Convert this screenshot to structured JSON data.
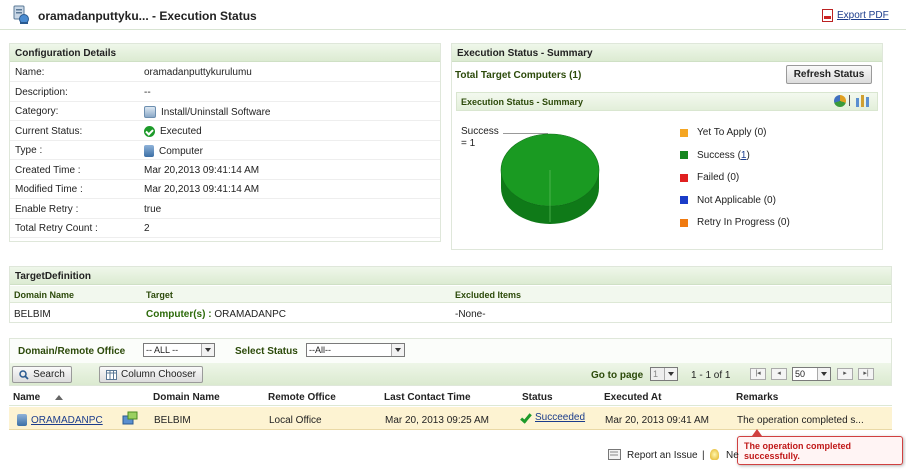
{
  "header": {
    "title": "oramadanputtyku... - Execution Status",
    "export_label": "Export PDF"
  },
  "config": {
    "heading": "Configuration Details",
    "rows": [
      {
        "label": "Name:",
        "value": "oramadanputtykurulumu",
        "icon": ""
      },
      {
        "label": "Description:",
        "value": "--",
        "icon": ""
      },
      {
        "label": "Category:",
        "value": "Install/Uninstall Software",
        "icon": "software-package-icon"
      },
      {
        "label": "Current Status:",
        "value": "Executed",
        "icon": "check-circle-icon"
      },
      {
        "label": "Type :",
        "value": "Computer",
        "icon": "computer-icon"
      },
      {
        "label": "Created Time :",
        "value": "Mar 20,2013 09:41:14 AM",
        "icon": ""
      },
      {
        "label": "Modified Time :",
        "value": "Mar 20,2013 09:41:14 AM",
        "icon": ""
      },
      {
        "label": "Enable Retry :",
        "value": "true",
        "icon": ""
      },
      {
        "label": "Total Retry Count :",
        "value": "2",
        "icon": ""
      }
    ]
  },
  "summary": {
    "heading": "Execution Status - Summary",
    "total_targets": "Total Target Computers (1)",
    "refresh_label": "Refresh Status",
    "subheading": "Execution Status - Summary",
    "pie_label": "Success",
    "pie_value": "= 1",
    "legend": [
      {
        "label": "Yet To Apply (0)",
        "color": "#f5a623",
        "link": "",
        "after": ""
      },
      {
        "label": "Success (",
        "color": "#15871f",
        "link": "1",
        "after": ")"
      },
      {
        "label": "Failed (0)",
        "color": "#e02020",
        "link": "",
        "after": ""
      },
      {
        "label": "Not Applicable (0)",
        "color": "#1a3cc8",
        "link": "",
        "after": ""
      },
      {
        "label": "Retry In Progress (0)",
        "color": "#f07a10",
        "link": "",
        "after": ""
      }
    ]
  },
  "chart_data": {
    "type": "pie",
    "categories": [
      "Success"
    ],
    "values": [
      1
    ],
    "colors": [
      "#1a9a22"
    ]
  },
  "target": {
    "heading": "TargetDefinition",
    "columns": [
      "Domain Name",
      "Target",
      "Excluded Items"
    ],
    "domain": "BELBIM",
    "target_prefix": "Computer(s) :",
    "target_value": "ORAMADANPC",
    "excluded": "-None-"
  },
  "filters": {
    "domain_label": "Domain/Remote Office",
    "domain_value": "-- ALL --",
    "status_label": "Select Status",
    "status_value": "--All--"
  },
  "toolbar": {
    "search_label": "Search",
    "chooser_label": "Column Chooser",
    "goto_label": "Go to page",
    "page_value": "1",
    "range": "1 - 1 of 1",
    "per_page": "50"
  },
  "grid": {
    "columns": [
      "Name",
      "Domain Name",
      "Remote Office",
      "Last Contact Time",
      "Status",
      "Executed At",
      "Remarks"
    ],
    "row": {
      "name": "ORAMADANPC",
      "domain": "BELBIM",
      "office": "Local Office",
      "last_contact": "Mar 20, 2013 09:25 AM",
      "status": "Succeeded",
      "executed_at": "Mar 20, 2013 09:41 AM",
      "remarks": "The operation completed s..."
    }
  },
  "tooltip": {
    "text": "The operation completed successfully."
  },
  "footer": {
    "report_label": "Report an Issue",
    "separator": "|",
    "next_label": "Ne"
  }
}
